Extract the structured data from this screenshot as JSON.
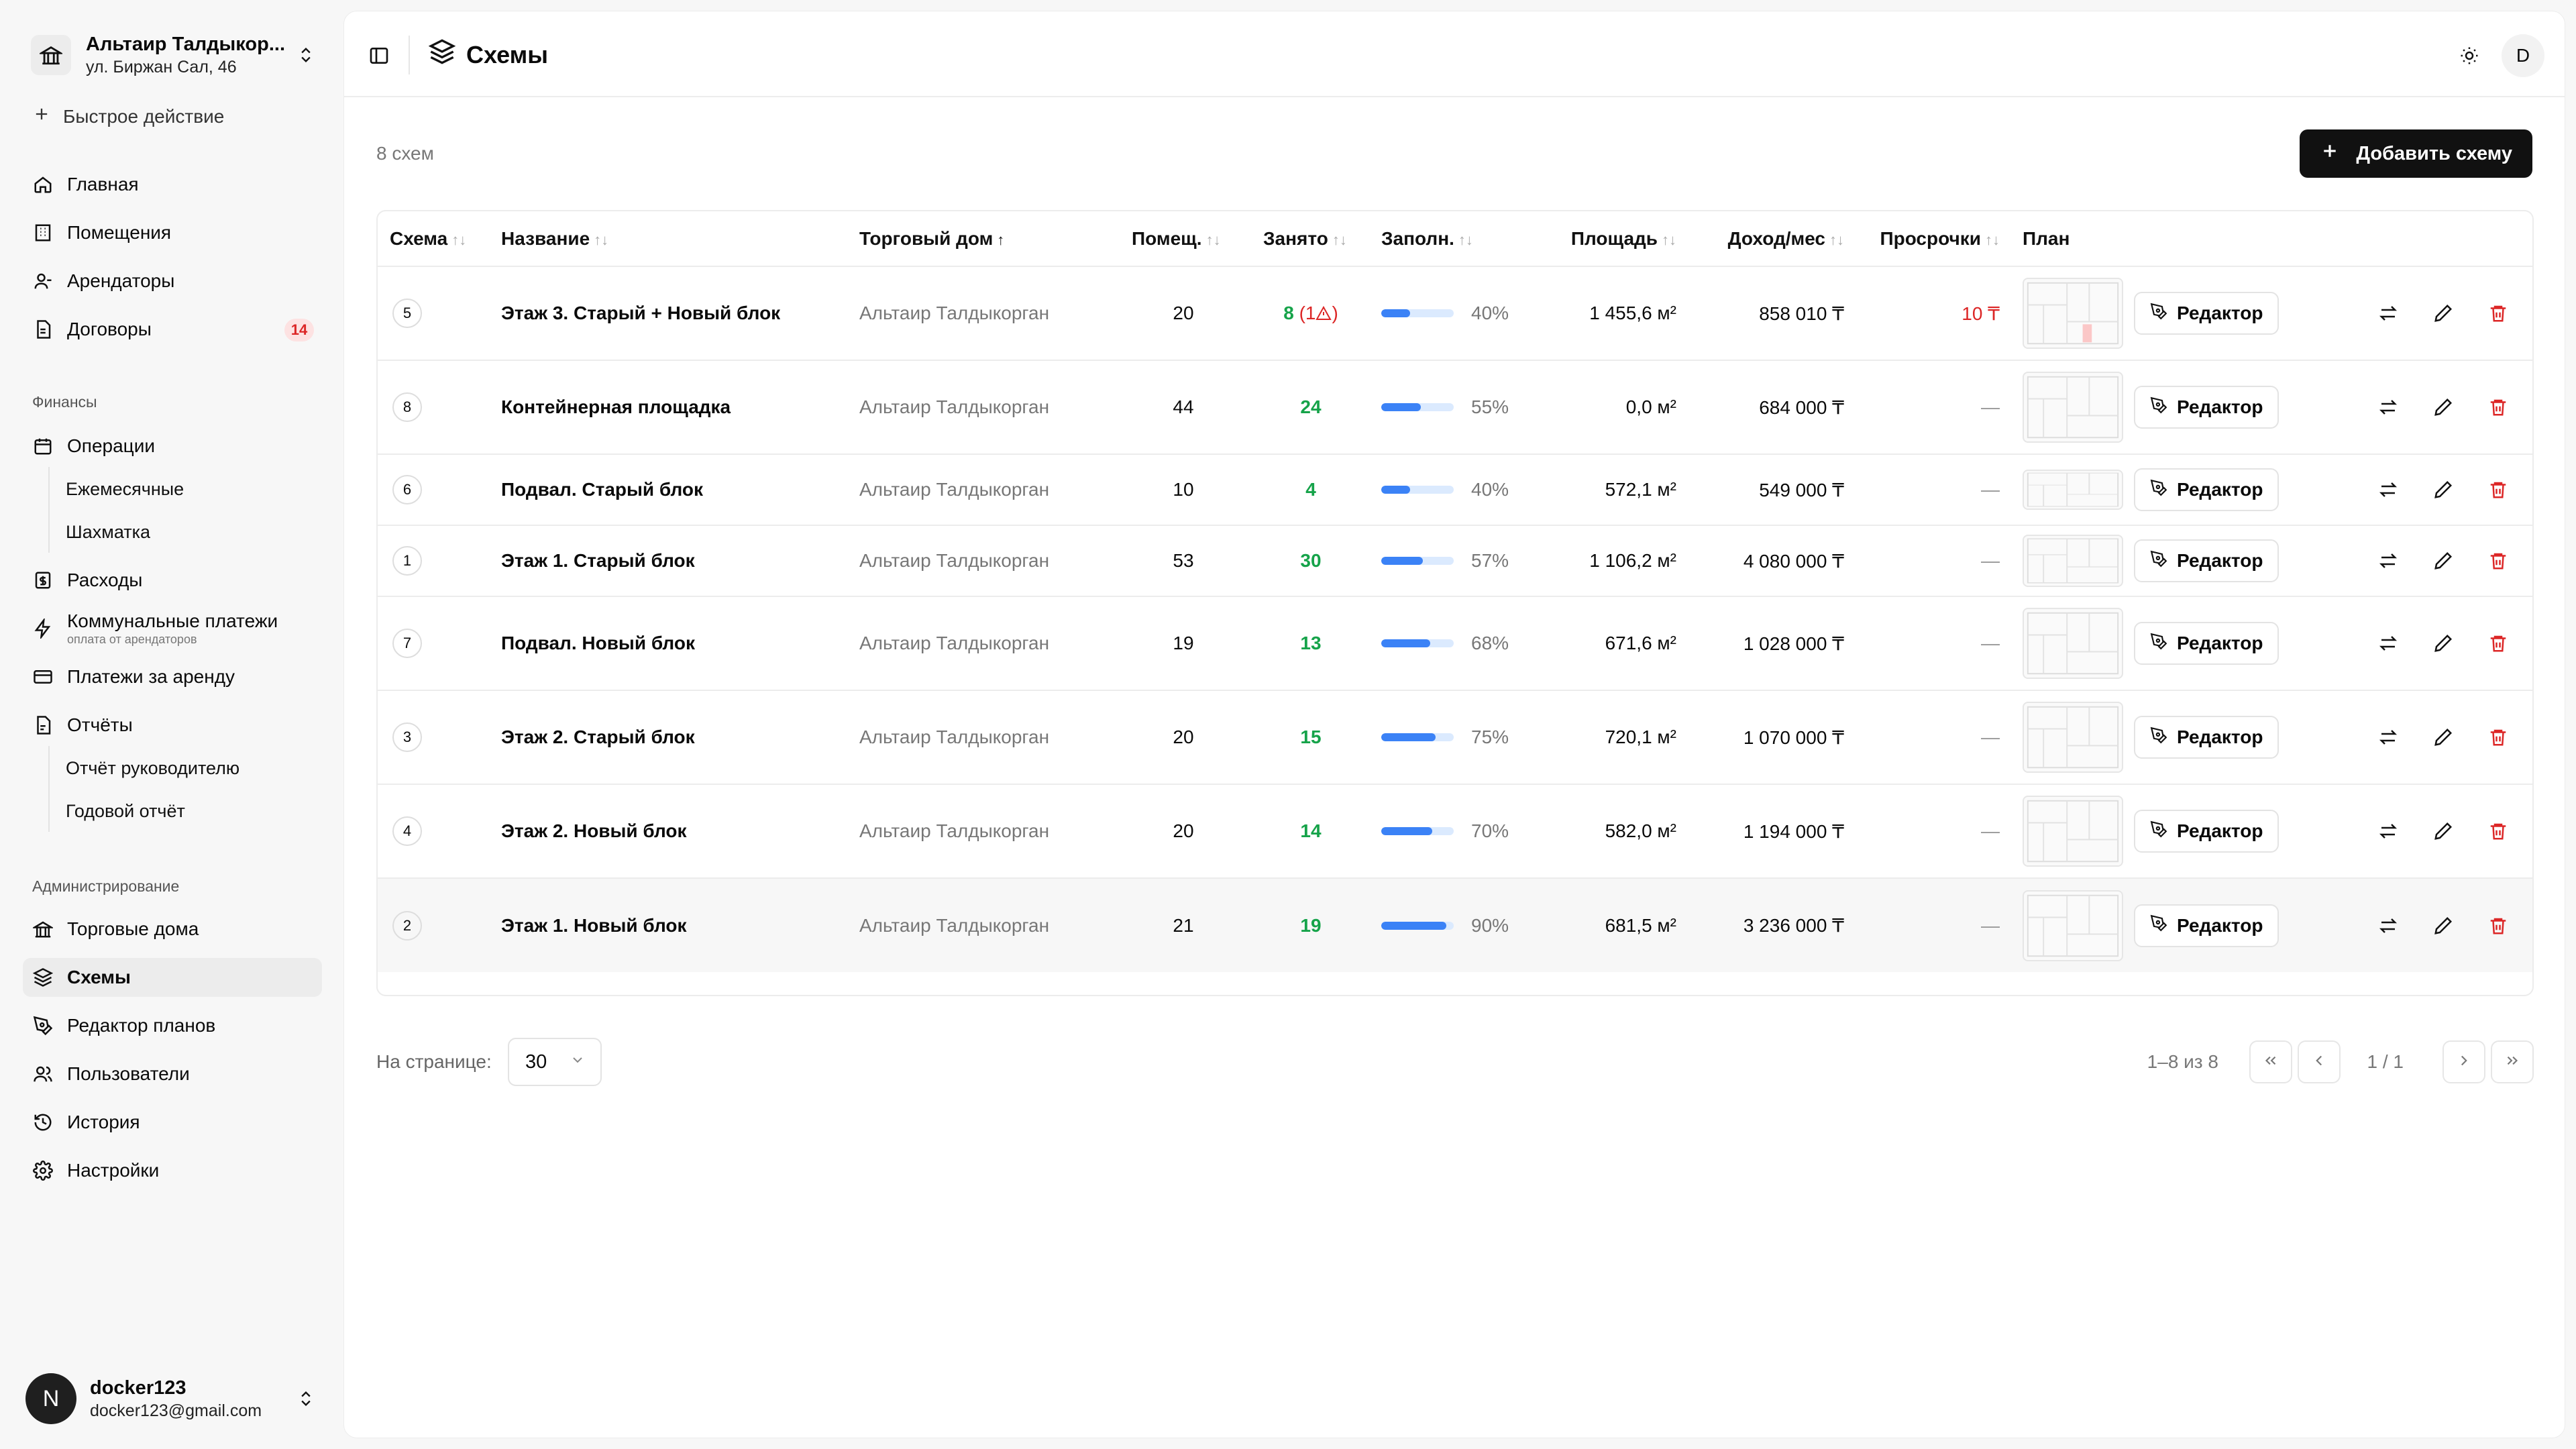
{
  "org": {
    "name": "Альтаир Талдыкор...",
    "address": "ул. Биржан Сал, 46"
  },
  "quick_action": "Быстрое действие",
  "nav": {
    "home": "Главная",
    "rooms": "Помещения",
    "tenants": "Арендаторы",
    "contracts": "Договоры",
    "contracts_badge": "14",
    "finance_section": "Финансы",
    "operations": "Операции",
    "monthly": "Ежемесячные",
    "chess": "Шахматка",
    "expenses": "Расходы",
    "utilities": "Коммунальные платежи",
    "utilities_sub": "оплата от арендаторов",
    "rent_payments": "Платежи за аренду",
    "reports": "Отчёты",
    "manager_report": "Отчёт руководителю",
    "annual_report": "Годовой отчёт",
    "admin_section": "Администрирование",
    "trade_houses": "Торговые дома",
    "schemes": "Схемы",
    "plan_editor": "Редактор планов",
    "users": "Пользователи",
    "history": "История",
    "settings": "Настройки"
  },
  "user": {
    "initial": "N",
    "name": "docker123",
    "email": "docker123@gmail.com"
  },
  "header": {
    "title": "Схемы",
    "avatar": "D"
  },
  "toolbar": {
    "count": "8 схем",
    "add_label": "Добавить схему"
  },
  "table": {
    "headers": {
      "scheme": "Схема",
      "name": "Название",
      "house": "Торговый дом",
      "rooms": "Помещ.",
      "occupied": "Занято",
      "fill": "Заполн.",
      "area": "Площадь",
      "income": "Доход/мес",
      "overdue": "Просрочки",
      "plan": "План"
    },
    "sort_icon": "↑↓",
    "sort_active_icon": "↑",
    "editor_label": "Редактор",
    "rows": [
      {
        "num": "5",
        "name": "Этаж 3. Старый + Новый блок",
        "house": "Альтаир Талдыкорган",
        "rooms": "20",
        "occupied": "8",
        "occupied_warn": "(1",
        "fill": 0.4,
        "fill_label": "40%",
        "area": "1 455,6 м²",
        "income": "858 010 ₸",
        "overdue": "10 ₸"
      },
      {
        "num": "8",
        "name": "Контейнерная площадка",
        "house": "Альтаир Талдыкорган",
        "rooms": "44",
        "occupied": "24",
        "occupied_warn": "",
        "fill": 0.55,
        "fill_label": "55%",
        "area": "0,0 м²",
        "income": "684 000 ₸",
        "overdue": "—"
      },
      {
        "num": "6",
        "name": "Подвал. Старый блок",
        "house": "Альтаир Талдыкорган",
        "rooms": "10",
        "occupied": "4",
        "occupied_warn": "",
        "fill": 0.4,
        "fill_label": "40%",
        "area": "572,1 м²",
        "income": "549 000 ₸",
        "overdue": "—"
      },
      {
        "num": "1",
        "name": "Этаж 1. Старый блок",
        "house": "Альтаир Талдыкорган",
        "rooms": "53",
        "occupied": "30",
        "occupied_warn": "",
        "fill": 0.57,
        "fill_label": "57%",
        "area": "1 106,2 м²",
        "income": "4 080 000 ₸",
        "overdue": "—"
      },
      {
        "num": "7",
        "name": "Подвал. Новый блок",
        "house": "Альтаир Талдыкорган",
        "rooms": "19",
        "occupied": "13",
        "occupied_warn": "",
        "fill": 0.68,
        "fill_label": "68%",
        "area": "671,6 м²",
        "income": "1 028 000 ₸",
        "overdue": "—"
      },
      {
        "num": "3",
        "name": "Этаж 2. Старый блок",
        "house": "Альтаир Талдыкорган",
        "rooms": "20",
        "occupied": "15",
        "occupied_warn": "",
        "fill": 0.75,
        "fill_label": "75%",
        "area": "720,1 м²",
        "income": "1 070 000 ₸",
        "overdue": "—"
      },
      {
        "num": "4",
        "name": "Этаж 2. Новый блок",
        "house": "Альтаир Талдыкорган",
        "rooms": "20",
        "occupied": "14",
        "occupied_warn": "",
        "fill": 0.7,
        "fill_label": "70%",
        "area": "582,0 м²",
        "income": "1 194 000 ₸",
        "overdue": "—"
      },
      {
        "num": "2",
        "name": "Этаж 1. Новый блок",
        "house": "Альтаир Талдыкорган",
        "rooms": "21",
        "occupied": "19",
        "occupied_warn": "",
        "fill": 0.9,
        "fill_label": "90%",
        "area": "681,5 м²",
        "income": "3 236 000 ₸",
        "overdue": "—"
      }
    ]
  },
  "pagination": {
    "per_page_label": "На странице:",
    "per_page": "30",
    "range": "1–8 из 8",
    "page": "1 / 1"
  },
  "colors": {
    "accent": "#3b82f6",
    "success": "#16a34a",
    "danger": "#dc2626",
    "primary_button": "#111111"
  }
}
